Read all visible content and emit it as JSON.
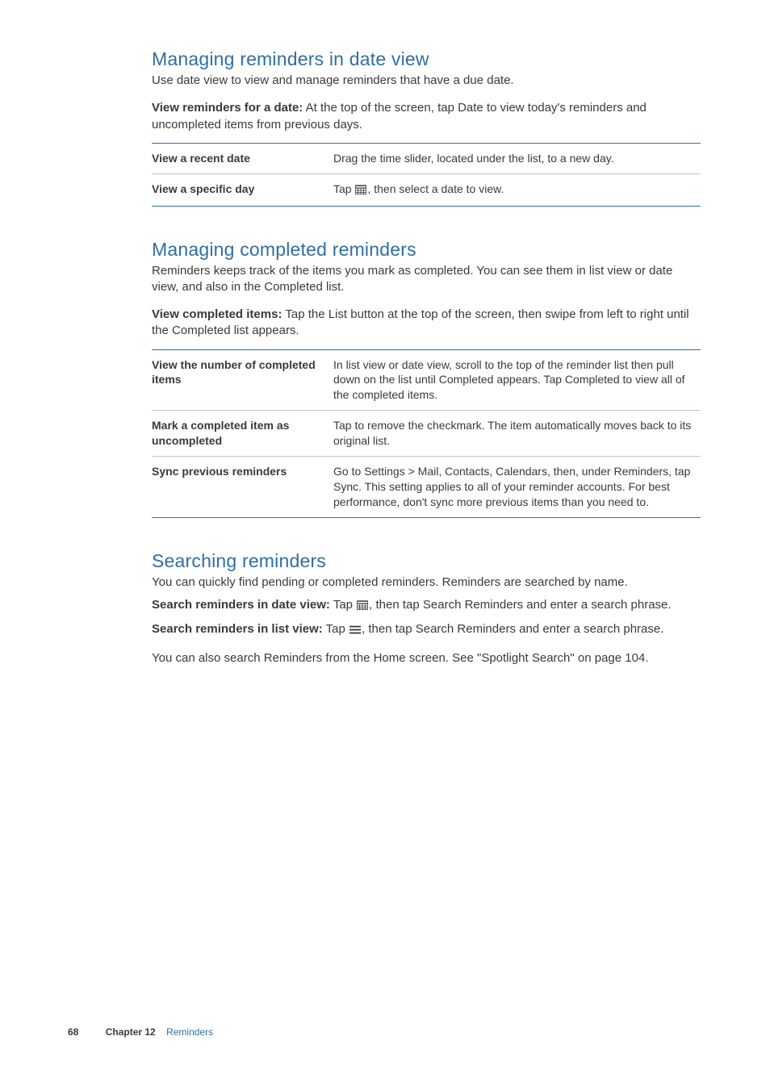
{
  "sections": {
    "date_view": {
      "heading": "Managing reminders in date view",
      "intro": "Use date view to view and manage reminders that have a due date.",
      "lead_label": "View reminders for a date:",
      "lead_text": "  At the top of the screen, tap Date to view today's reminders and uncompleted items from previous days.",
      "rows": [
        {
          "k": "View a recent date",
          "v_pre": "Drag the time slider, located under the list, to a new day.",
          "icon": null,
          "v_post": ""
        },
        {
          "k": "View a specific day",
          "v_pre": "Tap ",
          "icon": "calendar-icon",
          "v_post": ", then select a date to view."
        }
      ]
    },
    "completed": {
      "heading": "Managing completed reminders",
      "intro": "Reminders keeps track of the items you mark as completed. You can see them in list view or date view, and also in the Completed list.",
      "lead_label": "View completed items:",
      "lead_text": "  Tap the List button at the top of the screen, then swipe from left to right until the Completed list appears.",
      "rows": [
        {
          "k": "View the number of completed items",
          "v_pre": "In list view or date view, scroll to the top of the reminder list then pull down on the list until Completed appears. Tap Completed to view all of the completed items.",
          "icon": null,
          "v_post": ""
        },
        {
          "k": "Mark a completed item as uncompleted",
          "v_pre": "Tap to remove the checkmark. The item automatically moves back to its original list.",
          "icon": null,
          "v_post": ""
        },
        {
          "k": "Sync previous reminders",
          "v_pre": "Go to Settings > Mail, Contacts, Calendars, then, under Reminders, tap Sync. This setting applies to all of your reminder accounts. For best performance, don't sync more previous items than you need to.",
          "icon": null,
          "v_post": ""
        }
      ]
    },
    "searching": {
      "heading": "Searching reminders",
      "intro": "You can quickly find pending or completed reminders. Reminders are searched by name.",
      "p1_label": "Search reminders in date view:",
      "p1_pre": "  Tap ",
      "p1_icon": "calendar-icon",
      "p1_post": ", then tap Search Reminders and enter a search phrase.",
      "p2_label": "Search reminders in list view:",
      "p2_pre": "  Tap ",
      "p2_icon": "list-icon",
      "p2_post": ", then tap Search Reminders and enter a search phrase.",
      "closing_pre": "You can also search Reminders from the Home screen. See \"",
      "closing_link": "Spotlight Search",
      "closing_post": "\" on page ",
      "closing_page": "104",
      "closing_end": "."
    }
  },
  "footer": {
    "page_number": "68",
    "chapter_label": "Chapter 12",
    "chapter_title": "Reminders"
  },
  "icons": {
    "calendar-icon": "calendar",
    "list-icon": "list"
  }
}
